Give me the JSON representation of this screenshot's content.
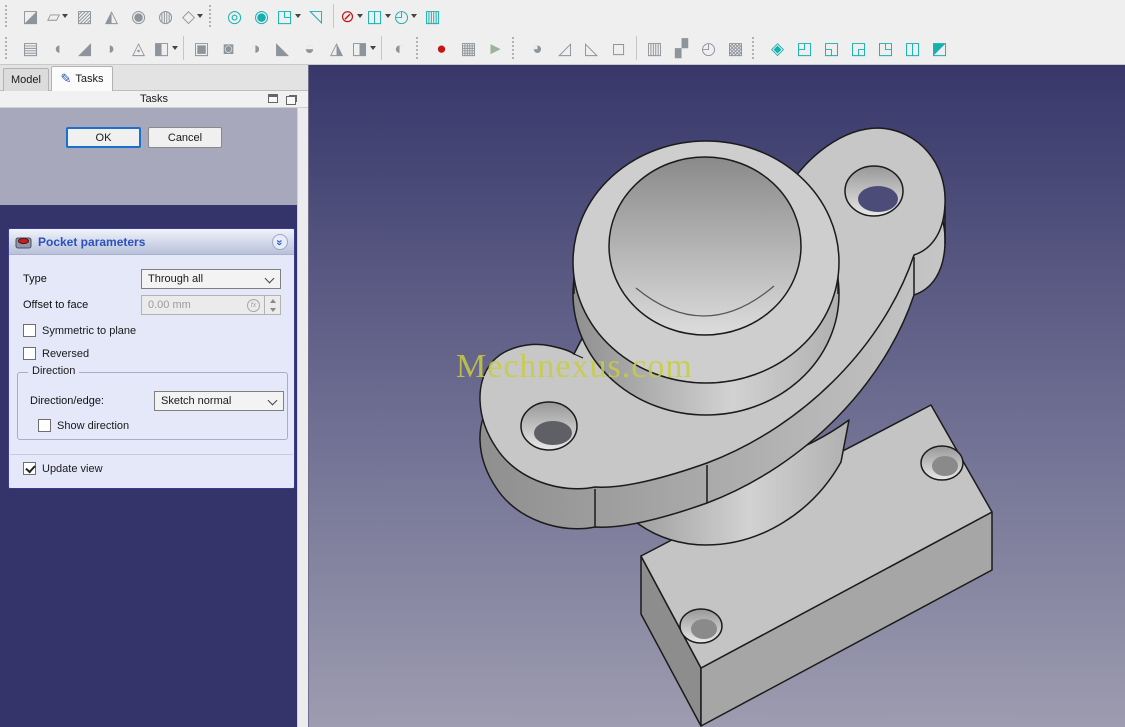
{
  "toolbars": {
    "row1": [
      {
        "type": "handle"
      },
      {
        "type": "icon",
        "name": "create-body",
        "glyph": "◪",
        "color": "#8d949b",
        "dropdown": false
      },
      {
        "type": "icon",
        "name": "create-sketch",
        "glyph": "▱",
        "color": "#8d949b",
        "dropdown": true
      },
      {
        "type": "icon",
        "name": "edit-sketch",
        "glyph": "▨",
        "color": "#8d949b",
        "dropdown": false
      },
      {
        "type": "icon",
        "name": "map-sketch",
        "glyph": "◭",
        "color": "#8d949b",
        "dropdown": false
      },
      {
        "type": "icon",
        "name": "shape-binder",
        "glyph": "◉",
        "color": "#8d949b",
        "dropdown": false
      },
      {
        "type": "icon",
        "name": "clone",
        "glyph": "◍",
        "color": "#8d949b",
        "dropdown": false
      },
      {
        "type": "icon",
        "name": "create-datum",
        "glyph": "◇",
        "color": "#8d949b",
        "dropdown": true
      },
      {
        "type": "handle"
      },
      {
        "type": "icon",
        "name": "fit-all",
        "glyph": "◎",
        "color": "#17b0b0",
        "dropdown": false
      },
      {
        "type": "icon",
        "name": "zoom-selection",
        "glyph": "◉",
        "color": "#17b0b0",
        "dropdown": false
      },
      {
        "type": "icon",
        "name": "axonometric-view",
        "glyph": "◳",
        "color": "#17b0b0",
        "dropdown": true
      },
      {
        "type": "icon",
        "name": "align-view-to-plane",
        "glyph": "◹",
        "color": "#17b0b0",
        "dropdown": false
      },
      {
        "type": "sep"
      },
      {
        "type": "icon",
        "name": "clipping-plane",
        "glyph": "⊘",
        "color": "#c41616",
        "dropdown": true
      },
      {
        "type": "icon",
        "name": "draw-style-cube",
        "glyph": "◫",
        "color": "#17b0b0",
        "dropdown": true
      },
      {
        "type": "icon",
        "name": "sync-view",
        "glyph": "◴",
        "color": "#17b0b0",
        "dropdown": true
      },
      {
        "type": "icon",
        "name": "measure",
        "glyph": "▥",
        "color": "#17b0b0",
        "dropdown": false
      }
    ],
    "row2": [
      {
        "type": "handle"
      },
      {
        "type": "icon",
        "name": "pad",
        "glyph": "▤",
        "color": "#8d949b",
        "dropdown": false
      },
      {
        "type": "icon",
        "name": "revolution",
        "glyph": "◖",
        "color": "#8d949b",
        "dropdown": false
      },
      {
        "type": "icon",
        "name": "additive-loft",
        "glyph": "◢",
        "color": "#8d949b",
        "dropdown": false
      },
      {
        "type": "icon",
        "name": "additive-pipe",
        "glyph": "◗",
        "color": "#8d949b",
        "dropdown": false
      },
      {
        "type": "icon",
        "name": "additive-helix",
        "glyph": "◬",
        "color": "#8d949b",
        "dropdown": false
      },
      {
        "type": "icon",
        "name": "additive-primitive",
        "glyph": "◧",
        "color": "#8d949b",
        "dropdown": true
      },
      {
        "type": "sep"
      },
      {
        "type": "icon",
        "name": "pocket",
        "glyph": "▣",
        "color": "#8d949b",
        "dropdown": false
      },
      {
        "type": "icon",
        "name": "hole",
        "glyph": "◙",
        "color": "#8d949b",
        "dropdown": false
      },
      {
        "type": "icon",
        "name": "groove",
        "glyph": "◑",
        "color": "#8d949b",
        "dropdown": false
      },
      {
        "type": "icon",
        "name": "subtractive-loft",
        "glyph": "◣",
        "color": "#8d949b",
        "dropdown": false
      },
      {
        "type": "icon",
        "name": "subtractive-pipe",
        "glyph": "◒",
        "color": "#8d949b",
        "dropdown": false
      },
      {
        "type": "icon",
        "name": "subtractive-helix",
        "glyph": "◮",
        "color": "#8d949b",
        "dropdown": false
      },
      {
        "type": "icon",
        "name": "subtractive-primitive",
        "glyph": "◨",
        "color": "#8d949b",
        "dropdown": true
      },
      {
        "type": "sep"
      },
      {
        "type": "icon",
        "name": "boolean-operation",
        "glyph": "◐",
        "color": "#8d949b",
        "dropdown": false
      },
      {
        "type": "handle"
      },
      {
        "type": "icon",
        "name": "macro-record",
        "glyph": "●",
        "color": "#c41616",
        "dropdown": false
      },
      {
        "type": "icon",
        "name": "macro-edit",
        "glyph": "▦",
        "color": "#8d949b",
        "dropdown": false
      },
      {
        "type": "icon",
        "name": "macro-play",
        "glyph": "►",
        "color": "#9cb49c",
        "dropdown": false
      },
      {
        "type": "handle"
      },
      {
        "type": "icon",
        "name": "fillet",
        "glyph": "◕",
        "color": "#8d949b",
        "dropdown": false
      },
      {
        "type": "icon",
        "name": "chamfer",
        "glyph": "◿",
        "color": "#8d949b",
        "dropdown": false
      },
      {
        "type": "icon",
        "name": "draft",
        "glyph": "◺",
        "color": "#8d949b",
        "dropdown": false
      },
      {
        "type": "icon",
        "name": "thickness",
        "glyph": "◻",
        "color": "#8d949b",
        "dropdown": false
      },
      {
        "type": "sep"
      },
      {
        "type": "icon",
        "name": "linear-pattern",
        "glyph": "▥",
        "color": "#8d949b",
        "dropdown": false
      },
      {
        "type": "icon",
        "name": "mirrored",
        "glyph": "▞",
        "color": "#8d949b",
        "dropdown": false
      },
      {
        "type": "icon",
        "name": "polar-pattern",
        "glyph": "◴",
        "color": "#8d949b",
        "dropdown": false
      },
      {
        "type": "icon",
        "name": "multitransform",
        "glyph": "▩",
        "color": "#8d949b",
        "dropdown": false
      },
      {
        "type": "handle"
      },
      {
        "type": "icon",
        "name": "view-isometric",
        "glyph": "◈",
        "color": "#17b0b0",
        "dropdown": false
      },
      {
        "type": "icon",
        "name": "view-front",
        "glyph": "◰",
        "color": "#17b0b0",
        "dropdown": false
      },
      {
        "type": "icon",
        "name": "view-top",
        "glyph": "◱",
        "color": "#17b0b0",
        "dropdown": false
      },
      {
        "type": "icon",
        "name": "view-right",
        "glyph": "◲",
        "color": "#17b0b0",
        "dropdown": false
      },
      {
        "type": "icon",
        "name": "view-rear",
        "glyph": "◳",
        "color": "#17b0b0",
        "dropdown": false
      },
      {
        "type": "icon",
        "name": "view-bottom",
        "glyph": "◫",
        "color": "#17b0b0",
        "dropdown": false
      },
      {
        "type": "icon",
        "name": "view-left",
        "glyph": "◩",
        "color": "#17b0b0",
        "dropdown": false
      }
    ]
  },
  "tabs": {
    "model": "Model",
    "tasks": "Tasks"
  },
  "panel": {
    "title": "Tasks",
    "ok": "OK",
    "cancel": "Cancel"
  },
  "pocket": {
    "title": "Pocket parameters",
    "type_label": "Type",
    "type_value": "Through all",
    "offset_label": "Offset to face",
    "offset_value": "0.00 mm",
    "fx": "fx",
    "symmetric": "Symmetric to plane",
    "symmetric_checked": false,
    "reversed": "Reversed",
    "reversed_checked": false,
    "direction_group": "Direction",
    "direction_edge_label": "Direction/edge:",
    "direction_edge_value": "Sketch normal",
    "show_direction": "Show direction",
    "show_direction_checked": false,
    "update_view": "Update view",
    "update_view_checked": true
  },
  "viewport": {
    "watermark": "Mechnexus.com",
    "bg_top": "#37376a",
    "bg_bottom": "#9d9cb0"
  },
  "colors": {
    "accent_teal": "#17b0b0",
    "panel_dark": "#34346a",
    "band": "#a8a8bc",
    "focus_blue": "#1a70cf"
  }
}
